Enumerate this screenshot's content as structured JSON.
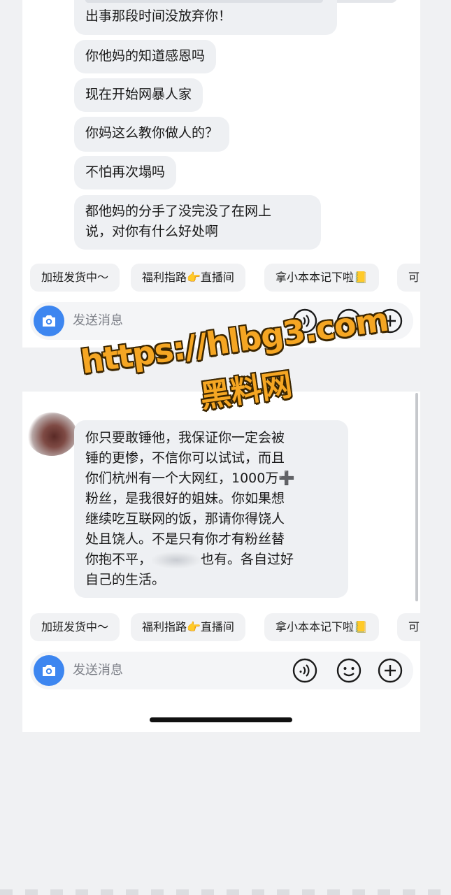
{
  "top_panel": {
    "cut_message_partial_line": "出事那段时间没放弃你！",
    "messages": [
      "你他妈的知道感恩吗",
      "现在开始网暴人家",
      "你妈这么教你做人的？",
      "不怕再次塌吗",
      "都他妈的分手了没完没了在网上\n说，对你有什么好处啊"
    ],
    "quick_replies": [
      "加班发货中～",
      "福利指路👉直播间",
      "拿小本本记下啦📒",
      "可"
    ],
    "input_placeholder": "发送消息"
  },
  "bottom_panel": {
    "message_parts": {
      "before_blur": "你只要敢锤他，我保证你一定会被\n锤的更惨，不信你可以试试，而且\n你们杭州有一个大网红，1000万➕\n粉丝，是我很好的姐妹。你如果想\n继续吃互联网的饭，那请你得饶人\n处且饶人。不是只有你才有粉丝替\n你抱不平，",
      "after_blur": "也有。各自过好\n自己的生活。"
    },
    "quick_replies": [
      "加班发货中～",
      "福利指路👉直播间",
      "拿小本本记下啦📒",
      "可"
    ],
    "input_placeholder": "发送消息"
  },
  "watermark": {
    "url": "https://hlbg3.com",
    "name": "黑料网"
  },
  "icons": {
    "camera": "camera-icon",
    "voice": "voice-icon",
    "emoji": "emoji-icon",
    "plus": "plus-icon"
  },
  "colors": {
    "accent": "#3d86f0",
    "bubble": "#eef0f3",
    "watermark": "#f5a623"
  }
}
